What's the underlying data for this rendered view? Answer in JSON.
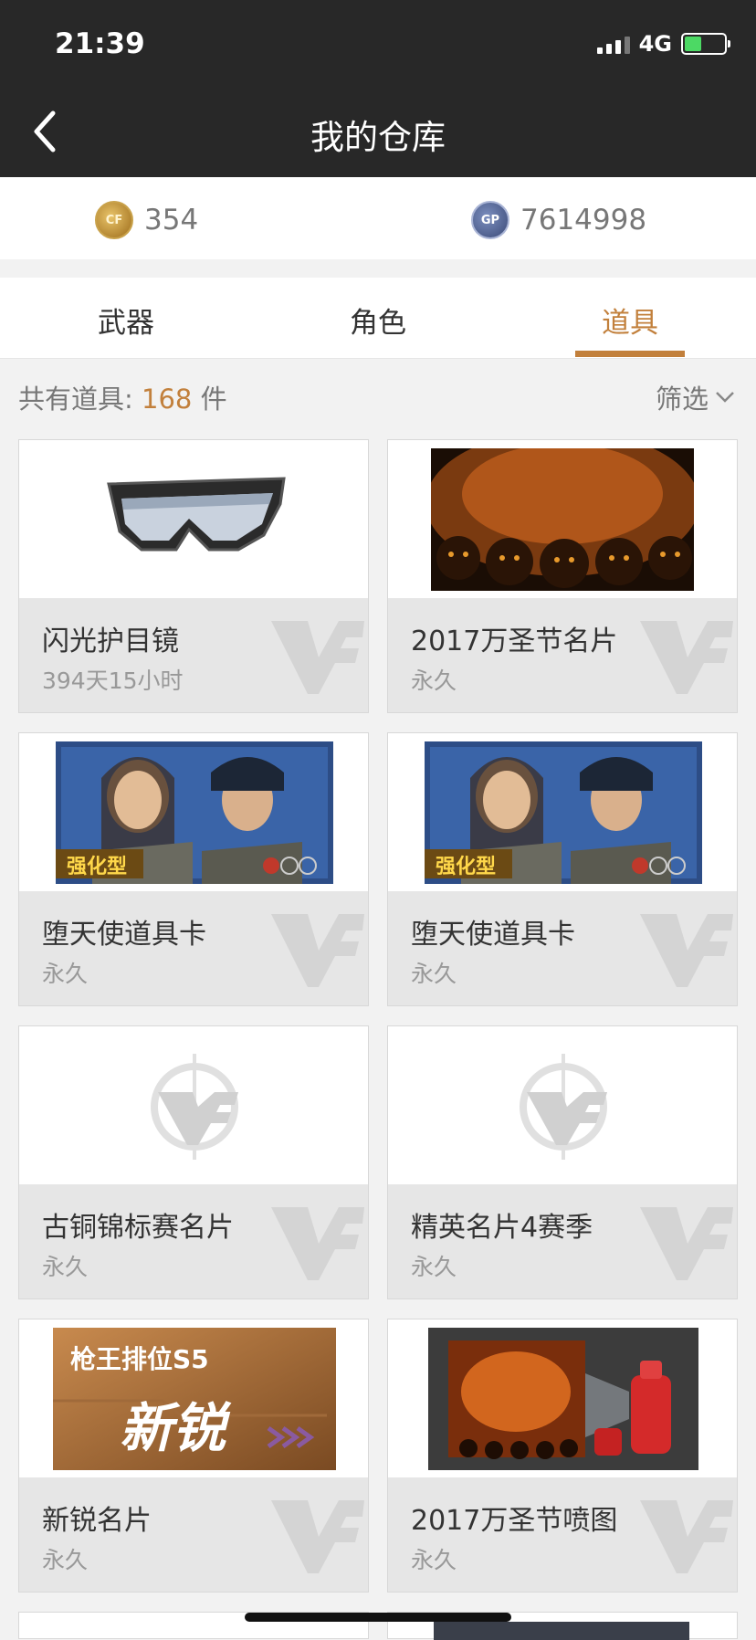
{
  "status_bar": {
    "time": "21:39",
    "network": "4G"
  },
  "header": {
    "title": "我的仓库"
  },
  "currency": {
    "cf_amount": "354",
    "gp_amount": "7614998",
    "gp_label": "GP"
  },
  "tabs": [
    {
      "label": "武器",
      "active": false
    },
    {
      "label": "角色",
      "active": false
    },
    {
      "label": "道具",
      "active": true
    }
  ],
  "summary": {
    "prefix": "共有道具:",
    "count": "168",
    "unit": "件"
  },
  "filter": {
    "label": "筛选"
  },
  "items": [
    {
      "name": "闪光护目镜",
      "duration": "394天15小时",
      "image": "goggles"
    },
    {
      "name": "2017万圣节名片",
      "duration": "永久",
      "image": "halloween-card"
    },
    {
      "name": "堕天使道具卡",
      "duration": "永久",
      "image": "fallen-angel-card"
    },
    {
      "name": "堕天使道具卡",
      "duration": "永久",
      "image": "fallen-angel-card"
    },
    {
      "name": "古铜锦标赛名片",
      "duration": "永久",
      "image": "placeholder-logo"
    },
    {
      "name": "精英名片4赛季",
      "duration": "永久",
      "image": "placeholder-logo"
    },
    {
      "name": "新锐名片",
      "duration": "永久",
      "image": "rookie-card"
    },
    {
      "name": "2017万圣节喷图",
      "duration": "永久",
      "image": "halloween-spray"
    }
  ],
  "art_text": {
    "rookie_line1": "枪王排位S5",
    "rookie_line2": "新锐",
    "enhanced": "强化型"
  },
  "colors": {
    "accent": "#c2803c",
    "header_bg": "#282828"
  }
}
